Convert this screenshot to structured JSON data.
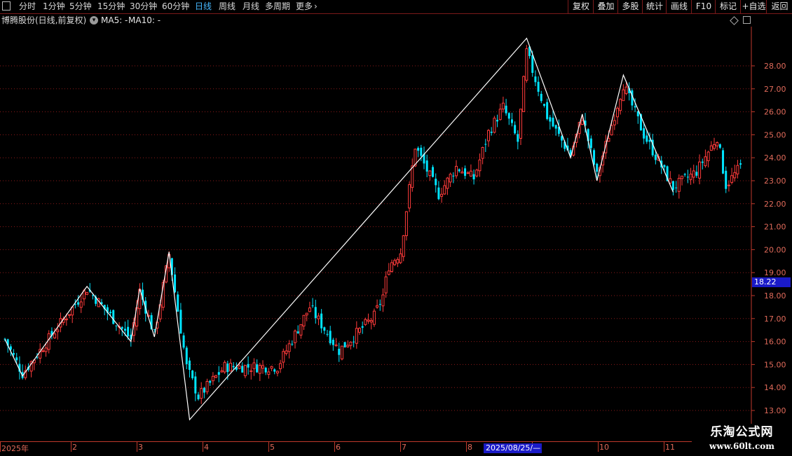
{
  "toolbar": {
    "periods": [
      {
        "label": "分时",
        "active": false
      },
      {
        "label": "1分钟",
        "active": false
      },
      {
        "label": "5分钟",
        "active": false
      },
      {
        "label": "15分钟",
        "active": false
      },
      {
        "label": "30分钟",
        "active": false
      },
      {
        "label": "60分钟",
        "active": false
      },
      {
        "label": "日线",
        "active": true
      },
      {
        "label": "周线",
        "active": false
      },
      {
        "label": "月线",
        "active": false
      },
      {
        "label": "多周期",
        "active": false
      },
      {
        "label": "更多",
        "active": false
      }
    ],
    "right_buttons": [
      "复权",
      "叠加",
      "多股",
      "统计",
      "画线",
      "F10",
      "标记",
      "+自选",
      "返回"
    ]
  },
  "chart_header": {
    "title": "博腾股份(日线,前复权)",
    "ma5": "MA5: -",
    "ma10": "MA10: -"
  },
  "chart_data": {
    "type": "candlestick",
    "colors": {
      "up": "#ff3b3b",
      "down": "#00e5ff",
      "grid": "#8b1a1a",
      "axis": "#c0392b",
      "zigzag": "#ffffff"
    },
    "ylim": [
      12.4,
      29.5
    ],
    "y_ticks": [
      "13.00",
      "14.00",
      "15.00",
      "16.00",
      "17.00",
      "18.00",
      "19.00",
      "20.00",
      "21.00",
      "22.00",
      "23.00",
      "24.00",
      "25.00",
      "26.00",
      "27.00",
      "28.00"
    ],
    "current_price": "18.22",
    "x_labels": [
      "2025年",
      "2",
      "3",
      "4",
      "5",
      "6",
      "7",
      "8",
      "9",
      "10",
      "11"
    ],
    "x_label_months": [
      1,
      2,
      3,
      4,
      5,
      6,
      7,
      8,
      9,
      10,
      11
    ],
    "crosshair_date": "2025/08/25/—",
    "zigzag": [
      {
        "t": 0,
        "p": 16.1
      },
      {
        "t": 6,
        "p": 14.5
      },
      {
        "t": 28,
        "p": 18.4
      },
      {
        "t": 43,
        "p": 16.0
      },
      {
        "t": 46,
        "p": 18.3
      },
      {
        "t": 51,
        "p": 16.2
      },
      {
        "t": 56,
        "p": 19.9
      },
      {
        "t": 63,
        "p": 12.6
      },
      {
        "t": 178,
        "p": 29.2
      },
      {
        "t": 193,
        "p": 24.0
      },
      {
        "t": 197,
        "p": 25.9
      },
      {
        "t": 202,
        "p": 23.0
      },
      {
        "t": 211,
        "p": 27.6
      },
      {
        "t": 228,
        "p": 22.5
      }
    ],
    "segments": [
      {
        "t0": 0,
        "p0": 16.1,
        "t1": 6,
        "p1": 14.6
      },
      {
        "t0": 6,
        "p0": 14.6,
        "t1": 28,
        "p1": 18.3
      },
      {
        "t0": 28,
        "p0": 18.3,
        "t1": 43,
        "p1": 16.1
      },
      {
        "t0": 43,
        "p0": 16.1,
        "t1": 46,
        "p1": 18.2
      },
      {
        "t0": 46,
        "p0": 18.2,
        "t1": 51,
        "p1": 16.3
      },
      {
        "t0": 51,
        "p0": 16.3,
        "t1": 56,
        "p1": 19.8
      },
      {
        "t0": 56,
        "p0": 19.8,
        "t1": 62,
        "p1": 14.9
      },
      {
        "t0": 62,
        "p0": 14.9,
        "t1": 66,
        "p1": 13.6
      },
      {
        "t0": 66,
        "p0": 13.6,
        "t1": 75,
        "p1": 14.9
      },
      {
        "t0": 75,
        "p0": 14.9,
        "t1": 93,
        "p1": 14.9
      },
      {
        "t0": 93,
        "p0": 14.9,
        "t1": 104,
        "p1": 17.5
      },
      {
        "t0": 104,
        "p0": 17.5,
        "t1": 114,
        "p1": 15.6
      },
      {
        "t0": 114,
        "p0": 15.6,
        "t1": 126,
        "p1": 17.1
      },
      {
        "t0": 126,
        "p0": 17.1,
        "t1": 129,
        "p1": 18.0
      },
      {
        "t0": 129,
        "p0": 18.0,
        "t1": 131,
        "p1": 19.3
      },
      {
        "t0": 131,
        "p0": 19.3,
        "t1": 135,
        "p1": 19.9
      },
      {
        "t0": 135,
        "p0": 19.9,
        "t1": 140,
        "p1": 24.5
      },
      {
        "t0": 140,
        "p0": 24.5,
        "t1": 148,
        "p1": 22.4
      },
      {
        "t0": 148,
        "p0": 22.4,
        "t1": 154,
        "p1": 23.6
      },
      {
        "t0": 154,
        "p0": 23.6,
        "t1": 160,
        "p1": 23.1
      },
      {
        "t0": 160,
        "p0": 23.1,
        "t1": 165,
        "p1": 25.1
      },
      {
        "t0": 165,
        "p0": 25.1,
        "t1": 170,
        "p1": 26.2
      },
      {
        "t0": 170,
        "p0": 26.2,
        "t1": 175,
        "p1": 24.7
      },
      {
        "t0": 175,
        "p0": 24.7,
        "t1": 178,
        "p1": 28.6
      },
      {
        "t0": 178,
        "p0": 28.6,
        "t1": 185,
        "p1": 25.8
      },
      {
        "t0": 185,
        "p0": 25.8,
        "t1": 193,
        "p1": 24.1
      },
      {
        "t0": 193,
        "p0": 24.1,
        "t1": 197,
        "p1": 25.8
      },
      {
        "t0": 197,
        "p0": 25.8,
        "t1": 202,
        "p1": 23.2
      },
      {
        "t0": 202,
        "p0": 23.2,
        "t1": 211,
        "p1": 27.2
      },
      {
        "t0": 211,
        "p0": 27.2,
        "t1": 218,
        "p1": 25.0
      },
      {
        "t0": 218,
        "p0": 25.0,
        "t1": 228,
        "p1": 22.7
      },
      {
        "t0": 228,
        "p0": 22.7,
        "t1": 236,
        "p1": 23.4
      },
      {
        "t0": 236,
        "p0": 23.4,
        "t1": 243,
        "p1": 24.9
      },
      {
        "t0": 243,
        "p0": 24.9,
        "t1": 246,
        "p1": 22.8
      },
      {
        "t0": 246,
        "p0": 22.8,
        "t1": 251,
        "p1": 23.6
      }
    ]
  },
  "price_tag": "18.22",
  "watermark": {
    "title": "乐淘公式网",
    "url": "www.60lt.com"
  }
}
